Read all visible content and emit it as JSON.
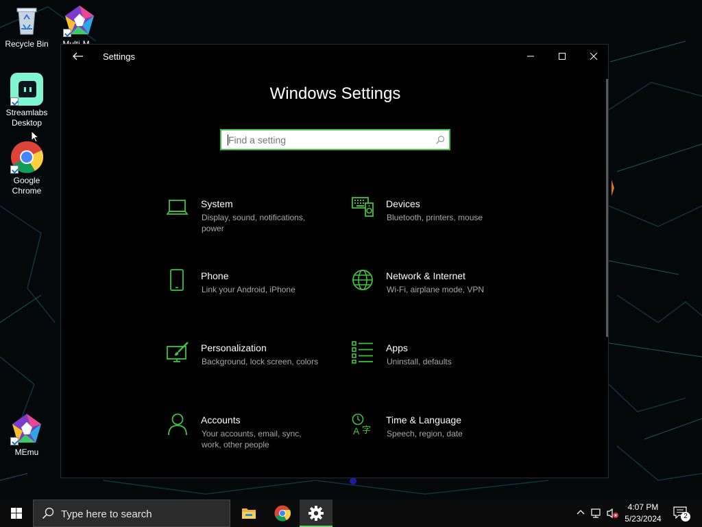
{
  "desktop": {
    "icons": [
      {
        "label": "Recycle Bin",
        "icon": "recycle-bin-icon"
      },
      {
        "label": "Multi-M...",
        "icon": "multi-memu-icon"
      },
      {
        "label": "Streamlabs Desktop",
        "icon": "streamlabs-icon"
      },
      {
        "label": "Google Chrome",
        "icon": "chrome-icon"
      },
      {
        "label": "MEmu",
        "icon": "memu-icon"
      }
    ]
  },
  "window": {
    "title": "Settings",
    "heading": "Windows Settings",
    "search": {
      "placeholder": "Find a setting"
    },
    "accent": "#3ec43e",
    "tiles": [
      {
        "name": "System",
        "desc": "Display, sound, notifications, power",
        "icon": "laptop-icon"
      },
      {
        "name": "Devices",
        "desc": "Bluetooth, printers, mouse",
        "icon": "keyboard-speaker-icon"
      },
      {
        "name": "Phone",
        "desc": "Link your Android, iPhone",
        "icon": "phone-icon"
      },
      {
        "name": "Network & Internet",
        "desc": "Wi-Fi, airplane mode, VPN",
        "icon": "globe-icon"
      },
      {
        "name": "Personalization",
        "desc": "Background, lock screen, colors",
        "icon": "paint-brush-icon"
      },
      {
        "name": "Apps",
        "desc": "Uninstall, defaults",
        "icon": "apps-list-icon"
      },
      {
        "name": "Accounts",
        "desc": "Your accounts, email, sync, work, other people",
        "icon": "person-icon"
      },
      {
        "name": "Time & Language",
        "desc": "Speech, region, date",
        "icon": "time-language-icon"
      }
    ]
  },
  "taskbar": {
    "search_text": "Type here to search",
    "time": "4:07 PM",
    "date": "5/23/2024",
    "notification_count": "2",
    "apps": [
      "file-explorer-icon",
      "chrome-icon",
      "settings-gear-icon"
    ]
  }
}
